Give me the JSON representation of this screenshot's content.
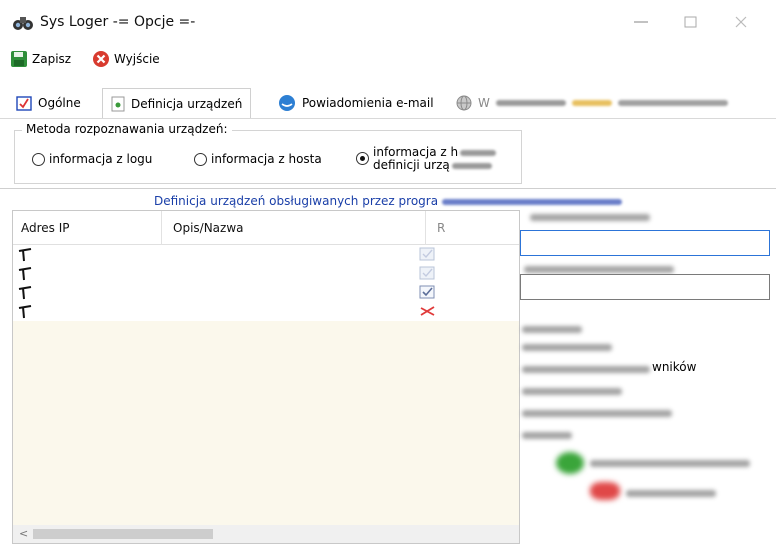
{
  "window": {
    "title": "Sys Loger -= Opcje =-",
    "icon": "binoculars-icon"
  },
  "toolbar": {
    "save_label": "Zapisz",
    "exit_label": "Wyjście"
  },
  "tabs": [
    {
      "label": "Ogólne",
      "icon": "checklist-icon"
    },
    {
      "label": "Definicja urządzeń",
      "icon": "document-icon",
      "active": true
    },
    {
      "label": "Powiadomienia e-mail",
      "icon": "mail-icon"
    },
    {
      "label": "W",
      "icon": "globe-icon"
    }
  ],
  "method_group": {
    "title": "Metoda rozpoznawania urządzeń:",
    "options": [
      {
        "label": "informacja z logu",
        "selected": false
      },
      {
        "label": "informacja z hosta",
        "selected": false
      },
      {
        "label_line1": "informacja z h",
        "label_line2": "definicji urzą",
        "selected": true
      }
    ]
  },
  "devices_section": {
    "caption": "Definicja urządzeń obsługiwanych przez progra",
    "columns": [
      "Adres IP",
      "Opis/Nazwa",
      "R"
    ],
    "rows": [
      {
        "marker": "arrow-marker-icon",
        "state": "checked-faded"
      },
      {
        "marker": "arrow-marker-icon",
        "state": "checked-faded"
      },
      {
        "marker": "arrow-marker-icon",
        "state": "checked"
      },
      {
        "marker": "arrow-marker-icon",
        "state": "cross"
      }
    ],
    "scroll_left": "<"
  },
  "right_panel": {
    "partial_label": "wników"
  },
  "colors": {
    "caption_blue": "#1a3fa8",
    "grid_empty_bg": "#fbf8ec",
    "cross_red": "#e03a3a",
    "focus_blue": "#2c74d8"
  }
}
